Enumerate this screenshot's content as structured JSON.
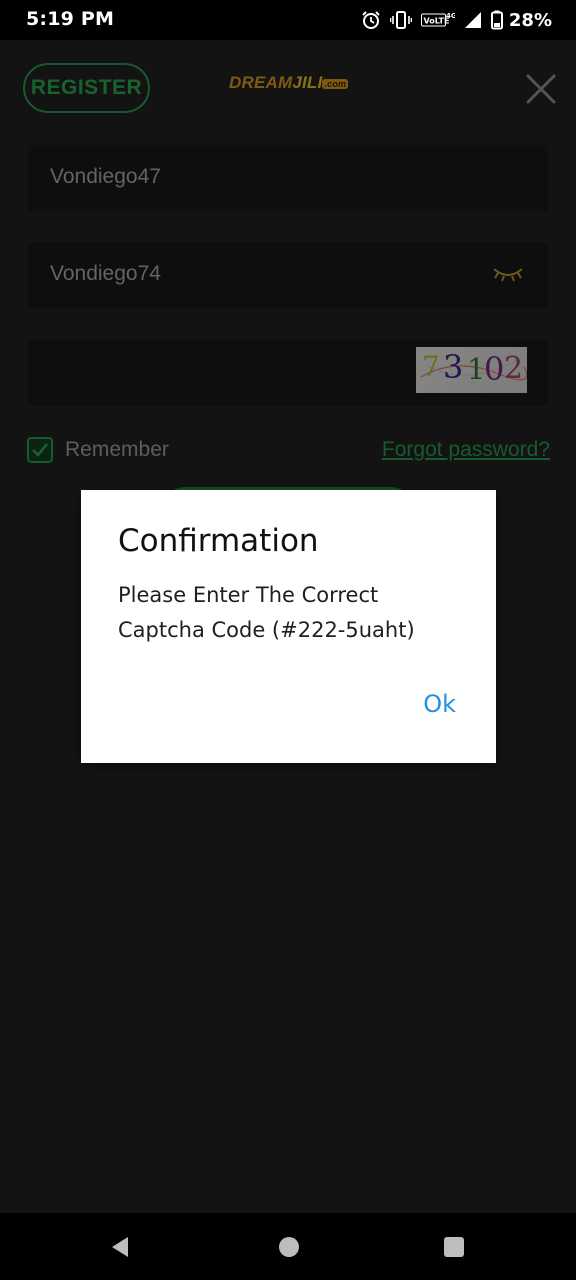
{
  "status_bar": {
    "time": "5:19 PM",
    "battery": "28%",
    "network": "4G",
    "volte": "VoLTE",
    "icons": [
      "alarm-icon",
      "vibrate-icon",
      "volte-icon",
      "signal-icon",
      "battery-icon"
    ]
  },
  "header": {
    "register_label": "REGISTER",
    "logo_text": "DREAM",
    "logo_text_2": "JILI",
    "logo_suffix": ".com"
  },
  "form": {
    "username_value": "Vondiego47",
    "password_value": "Vondiego74",
    "captcha_value": "",
    "captcha_digits": [
      "7",
      "3",
      "1",
      "0",
      "2"
    ],
    "remember_label": "Remember",
    "remember_checked": true,
    "forgot_label": "Forgot password?"
  },
  "dialog": {
    "title": "Confirmation",
    "message": "Please Enter The Correct Captcha Code (#222-5uaht)",
    "ok_label": "Ok"
  },
  "colors": {
    "accent_green": "#2aa552",
    "dialog_button_blue": "#2490e0",
    "app_background": "#232323"
  }
}
